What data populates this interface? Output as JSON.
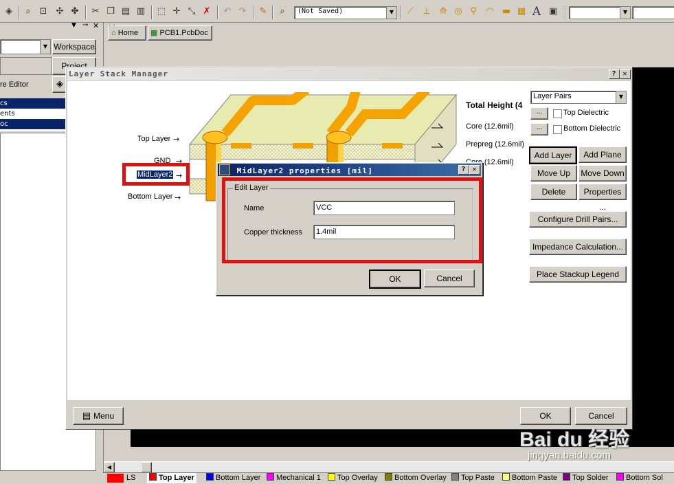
{
  "toolbar": {
    "view_combo": "(Not Saved)"
  },
  "workspace_panel": {
    "workspace_button": "Workspace",
    "project_button": "Project",
    "editor_label": "re Editor",
    "items": [
      "cs",
      "ents",
      "oc"
    ]
  },
  "doc_tabs": [
    {
      "label": "Home"
    },
    {
      "label": "PCB1.PcbDoc"
    }
  ],
  "layer_stack_manager": {
    "title": "Layer Stack Manager",
    "total_height": "Total Height (4",
    "left_labels": {
      "top_layer": "Top Layer",
      "gnd": "GND",
      "mid_layer2": "MidLayer2",
      "bottom_layer": "Bottom Layer"
    },
    "right_labels": {
      "core1": "Core (12.6mil)",
      "prepreg": "Prepreg (12.6mil)",
      "core2": "Core (12.6mil)"
    },
    "layer_pairs_combo": "Layer Pairs",
    "top_dielectric": "Top Dielectric",
    "bottom_dielectric": "Bottom Dielectric",
    "buttons": {
      "add_layer": "Add Layer",
      "add_plane": "Add Plane",
      "move_up": "Move Up",
      "move_down": "Move Down",
      "delete": "Delete",
      "properties": "Properties ...",
      "configure_drill_pairs": "Configure Drill Pairs...",
      "impedance_calculation": "Impedance Calculation...",
      "place_stackup_legend": "Place Stackup Legend",
      "menu": "Menu",
      "ok": "OK",
      "cancel": "Cancel"
    }
  },
  "properties_dialog": {
    "title": "MidLayer2 properties [mil]",
    "group_label": "Edit Layer",
    "name_label": "Name",
    "name_value": "VCC",
    "copper_label": "Copper thickness",
    "copper_value": "1.4mil",
    "ok": "OK",
    "cancel": "Cancel"
  },
  "layer_tabs": [
    {
      "label": "LS",
      "color": "#ff0000"
    },
    {
      "label": "Top Layer",
      "color": "#ff0000"
    },
    {
      "label": "Bottom Layer",
      "color": "#0000ff"
    },
    {
      "label": "Mechanical 1",
      "color": "#ff00ff"
    },
    {
      "label": "Top Overlay",
      "color": "#ffff00"
    },
    {
      "label": "Bottom Overlay",
      "color": "#808000"
    },
    {
      "label": "Top Paste",
      "color": "#808080"
    },
    {
      "label": "Bottom Paste",
      "color": "#ffff80"
    },
    {
      "label": "Top Solder",
      "color": "#800080"
    },
    {
      "label": "Bottom Sol",
      "color": "#ff00ff"
    }
  ],
  "watermark": {
    "brand": "Bai du 经验",
    "url": "jingyan.baidu.com"
  }
}
